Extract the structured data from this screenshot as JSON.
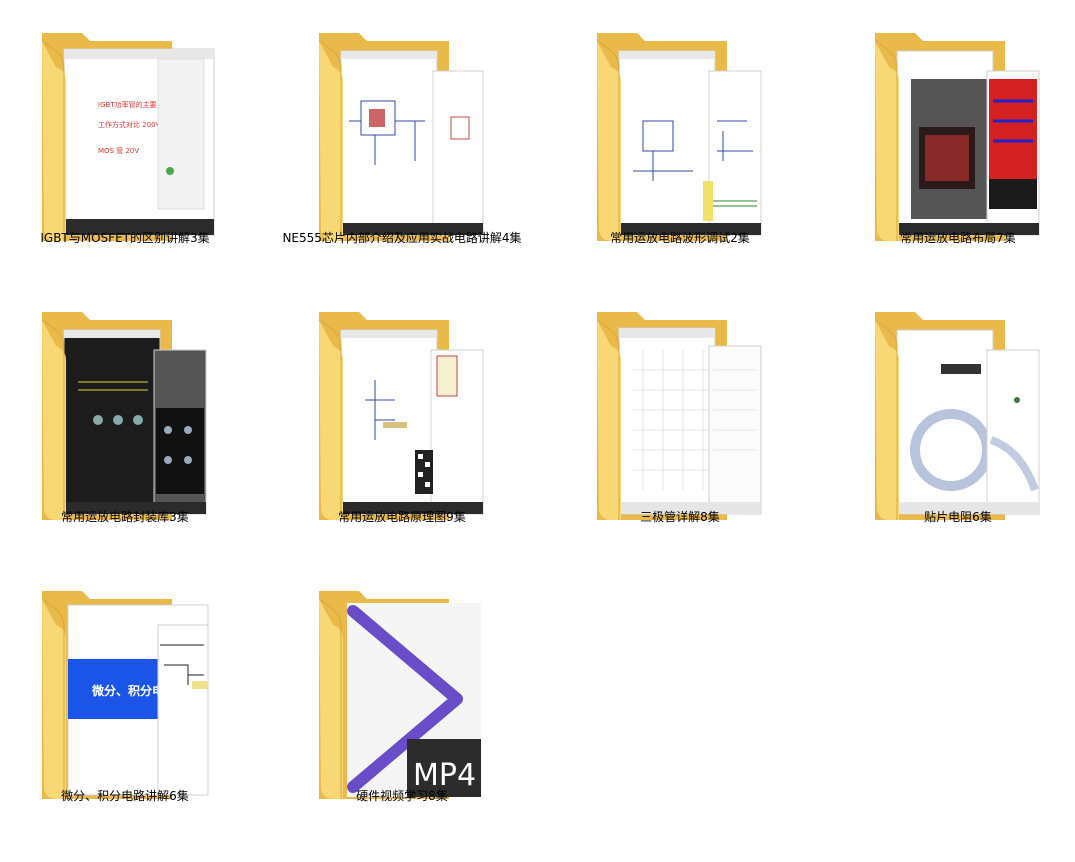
{
  "folders": [
    {
      "name": "IGBT与MOSFET的区别讲解3集",
      "preview": "slides-red"
    },
    {
      "name": "NE555芯片内部介绍及应用实战电路讲解4集",
      "preview": "schematic-blue"
    },
    {
      "name": "常用运放电路波形调试2集",
      "preview": "schematic-wave"
    },
    {
      "name": "常用运放电路布局7集",
      "preview": "pcb-red"
    },
    {
      "name": "常用运放电路封装库3集",
      "preview": "pcb-dark"
    },
    {
      "name": "常用运放电路原理图9集",
      "preview": "schematic-qr"
    },
    {
      "name": "三极管详解8集",
      "preview": "grid-sheet"
    },
    {
      "name": "贴片电阻6集",
      "preview": "logo-page"
    },
    {
      "name": "微分、积分电路讲解6集",
      "preview": "slide-blue",
      "overlay_text": "微分、积分电路的"
    },
    {
      "name": "硬件视频学习8集",
      "preview": "mp4",
      "overlay_text": "MP4"
    }
  ],
  "colors": {
    "folder_back": "#e9b949",
    "folder_front": "#f8d775",
    "folder_edge": "#d9a73a",
    "accent_purple": "#6a4cc9"
  }
}
